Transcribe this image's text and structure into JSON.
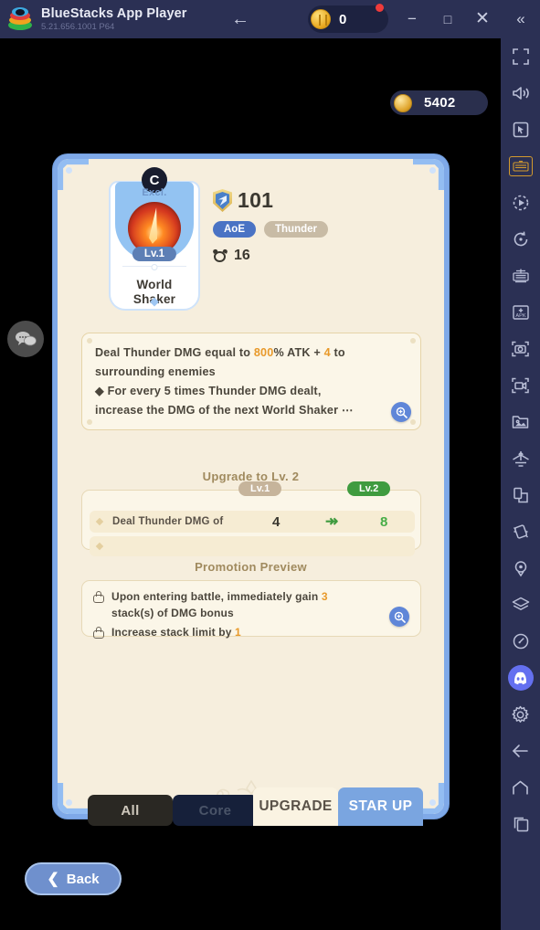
{
  "titlebar": {
    "app_title": "BlueStacks App Player",
    "version": "5.21.656.1001  P64",
    "back_icon": "←",
    "coin_value": "0",
    "minimize_icon": "−",
    "maximize_icon": "□",
    "close_icon": "✕",
    "collapse_icon": "«",
    "bg_color": "#2b3054"
  },
  "sidebar": {
    "items": [
      {
        "name": "fullscreen-icon",
        "label": "Fullscreen"
      },
      {
        "name": "volume-icon",
        "label": "Volume"
      },
      {
        "name": "pointer-icon",
        "label": "Mouse pointer"
      },
      {
        "name": "keyboard-controls-icon",
        "label": "Game controls"
      },
      {
        "name": "macro-record-icon",
        "label": "Macro"
      },
      {
        "name": "rotate-icon",
        "label": "Rotate"
      },
      {
        "name": "multi-instance-icon",
        "label": "Multi-instance manager"
      },
      {
        "name": "apk-install-icon",
        "label": "Install APK"
      },
      {
        "name": "screenshot-icon",
        "label": "Screenshot"
      },
      {
        "name": "video-record-icon",
        "label": "Record video"
      },
      {
        "name": "media-manager-icon",
        "label": "Media manager"
      },
      {
        "name": "eco-mode-icon",
        "label": "Eco mode"
      },
      {
        "name": "copy-paste-icon",
        "label": "Copy / paste"
      },
      {
        "name": "shake-icon",
        "label": "Shake"
      },
      {
        "name": "location-icon",
        "label": "Location"
      },
      {
        "name": "layers-icon",
        "label": "Layers"
      },
      {
        "name": "performance-icon",
        "label": "Performance"
      },
      {
        "name": "discord-icon",
        "label": "Discord"
      },
      {
        "name": "settings-gear-icon",
        "label": "Settings"
      },
      {
        "name": "android-back-icon",
        "label": "Back"
      },
      {
        "name": "android-home-icon",
        "label": "Home"
      },
      {
        "name": "android-recents-icon",
        "label": "Recents"
      }
    ],
    "highlight_index": 3,
    "highlight_color": "#d39a2e",
    "discord_color": "#6470f0"
  },
  "hud": {
    "currency_value": "5402",
    "chat_icon": "chat-bubbles-icon"
  },
  "card": {
    "nav_prev_icon": "❮",
    "nav_next_icon": "❯",
    "skill": {
      "rarity_badge": "C",
      "exclusive_text": "Excl.",
      "level_chip": "Lv.1",
      "name_line1": "World",
      "name_line2": "Shaker"
    },
    "meta": {
      "power_value": "101",
      "tag_primary": "AoE",
      "tag_element": "Thunder",
      "cooldown_value": "16"
    },
    "description": {
      "line1_pre": "Deal Thunder DMG equal to ",
      "line1_pct": "800",
      "line1_mid": "% ATK + ",
      "line1_num": "4",
      "line1_post": " to",
      "line2": "surrounding enemies",
      "line3": "◆ For every 5 times Thunder DMG dealt,",
      "line4": "increase the DMG of the next World Shaker ⋯",
      "magnifier_icon": "magnifier-plus-icon"
    },
    "upgrade": {
      "section_title": "Upgrade to Lv. 2",
      "col_from_label": "Lv.1",
      "col_to_label": "Lv.2",
      "rows": [
        {
          "label": "Deal Thunder DMG of",
          "from": "4",
          "arrow": "↠",
          "to": "8"
        },
        {
          "label": "",
          "from": "",
          "arrow": "",
          "to": ""
        }
      ]
    },
    "promotion": {
      "section_title": "Promotion Preview",
      "lines": [
        {
          "pre": "Upon entering battle, immediately gain ",
          "num": "3",
          "post": ""
        },
        {
          "pre": "stack(s) of DMG bonus",
          "num": "",
          "post": ""
        },
        {
          "pre": "Increase stack limit by ",
          "num": "1",
          "post": ""
        }
      ],
      "magnifier_icon": "magnifier-plus-icon"
    }
  },
  "tabs": {
    "all": "All",
    "core": "Core",
    "upgrade": "UPGRADE",
    "star_up": "STAR UP",
    "active": "UPGRADE"
  },
  "footer": {
    "back_label": "Back",
    "back_icon": "❮"
  },
  "colors": {
    "card_border": "#7fa9e8",
    "card_bg": "#f6eedd",
    "panel_bg": "#fbf6e8",
    "accent_orange": "#e8992a",
    "accent_green": "#3f9b3f",
    "tag_blue": "#4a73c4",
    "tag_beige": "#c8bba5",
    "title_brown": "#a08a5e"
  }
}
